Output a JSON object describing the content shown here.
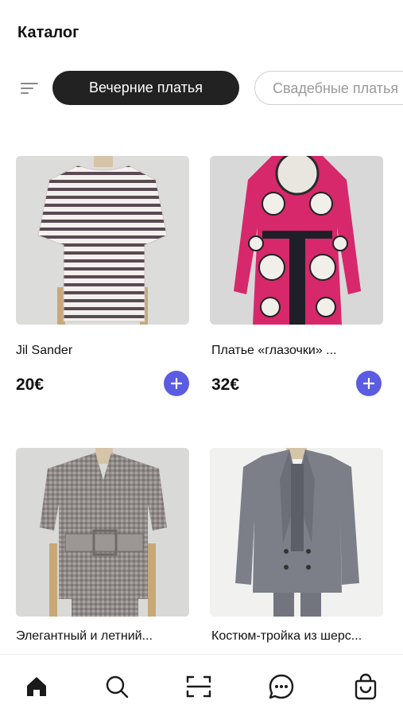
{
  "header": {
    "title": "Каталог"
  },
  "filters": {
    "menu_icon": "filter-lines-icon",
    "chips": [
      {
        "label": "Вечерние платья",
        "active": true
      },
      {
        "label": "Свадебные платья",
        "active": false
      }
    ]
  },
  "products": [
    {
      "name": "Jil Sander",
      "price": "20€",
      "image": "striped-tshirt-dress-photo"
    },
    {
      "name": "Платье «глазочки» ...",
      "price": "32€",
      "image": "floral-pink-dress-photo"
    },
    {
      "name": "Элегантный и летний...",
      "price": "",
      "image": "tweed-belted-jacket-photo"
    },
    {
      "name": "Костюм-тройка из шерс...",
      "price": "",
      "image": "grey-three-piece-suit-photo"
    }
  ],
  "bottom_nav": [
    {
      "icon": "home-icon",
      "active": true
    },
    {
      "icon": "search-icon",
      "active": false
    },
    {
      "icon": "scan-icon",
      "active": false
    },
    {
      "icon": "chat-icon",
      "active": false
    },
    {
      "icon": "shopping-bag-icon",
      "active": false
    }
  ],
  "colors": {
    "accent": "#5b5ce2",
    "chip_active_bg": "#222222",
    "text": "#111111"
  }
}
